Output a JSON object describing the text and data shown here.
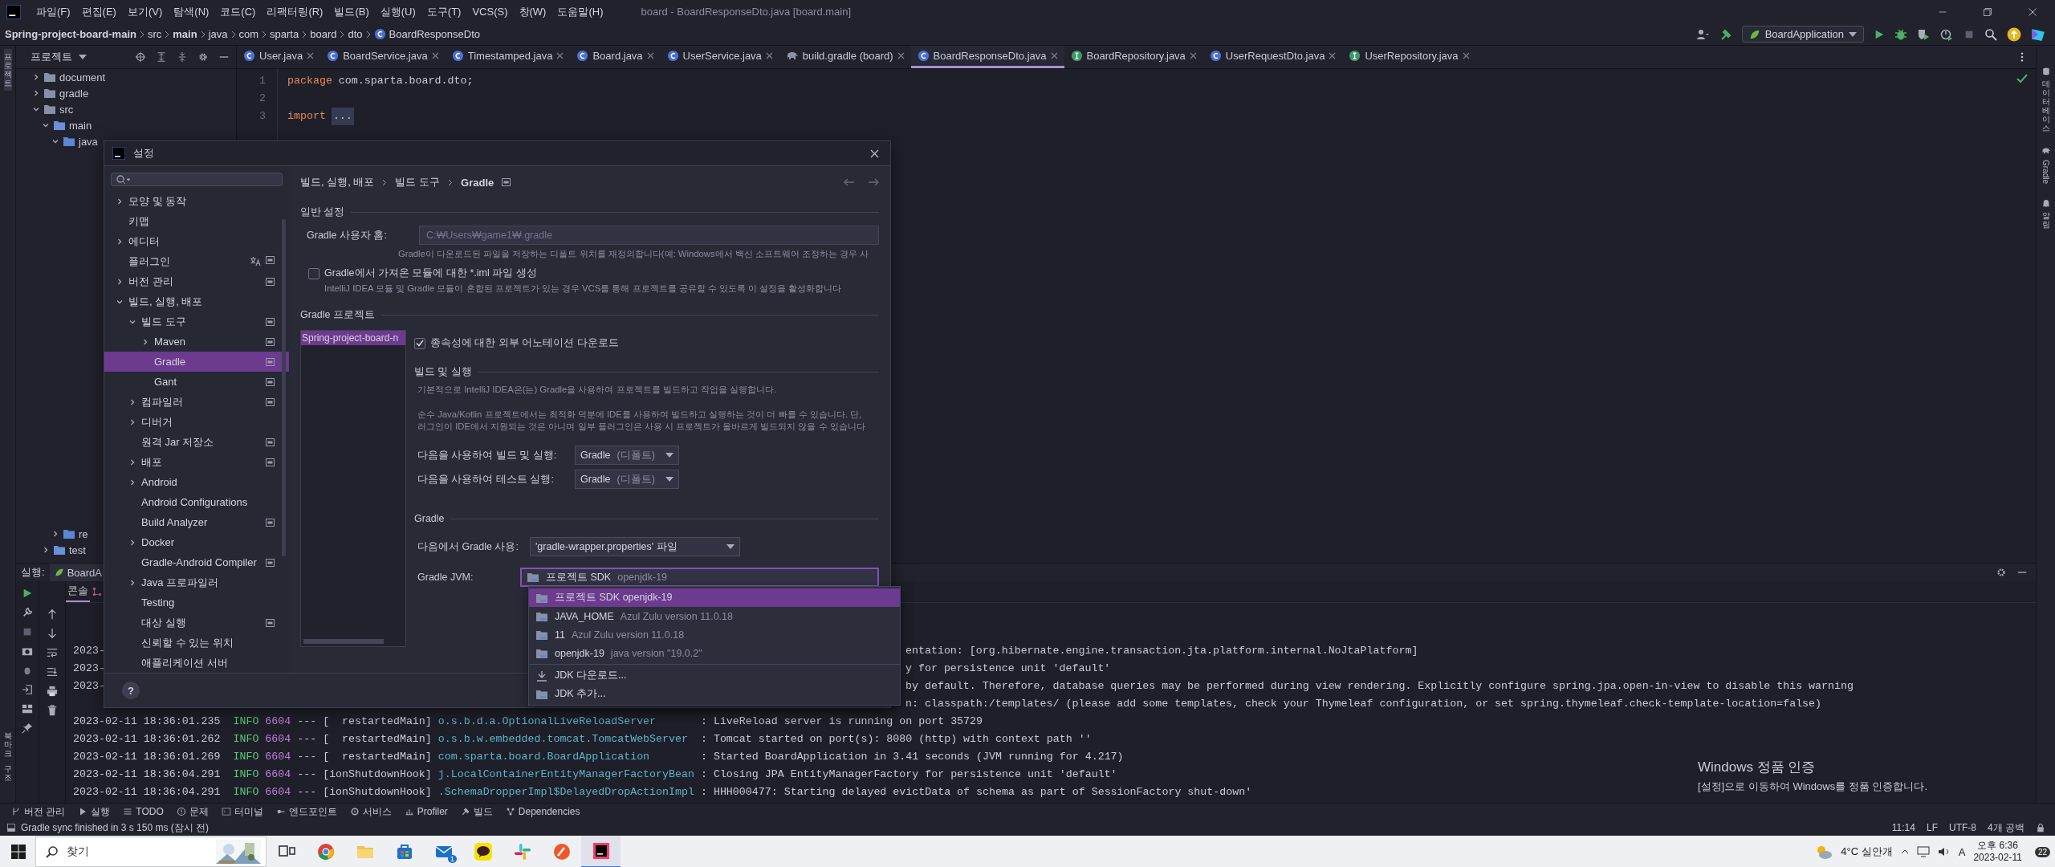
{
  "title_bar": {
    "menus": [
      "파일(F)",
      "편집(E)",
      "보기(V)",
      "탐색(N)",
      "코드(C)",
      "리팩터링(R)",
      "빌드(B)",
      "실행(U)",
      "도구(T)",
      "VCS(S)",
      "창(W)",
      "도움말(H)"
    ],
    "title": "board - BoardResponseDto.java [board.main]"
  },
  "breadcrumb": [
    {
      "label": "Spring-project-board-main",
      "kind": "root"
    },
    {
      "label": "src",
      "kind": "dir"
    },
    {
      "label": "main",
      "kind": "root"
    },
    {
      "label": "java",
      "kind": "dir"
    },
    {
      "label": "com",
      "kind": "dir"
    },
    {
      "label": "sparta",
      "kind": "dir"
    },
    {
      "label": "board",
      "kind": "dir"
    },
    {
      "label": "dto",
      "kind": "dir"
    },
    {
      "label": "BoardResponseDto",
      "kind": "class"
    }
  ],
  "run_config": "BoardApplication",
  "left_stripe": {
    "top": [
      "프로젝트"
    ],
    "bottom": [
      "북마크",
      "구조"
    ]
  },
  "right_stripe": [
    "데이터베이스",
    "Gradle",
    "알림"
  ],
  "project": {
    "title": "프로젝트",
    "tree": [
      {
        "name": "document",
        "expanded": false
      },
      {
        "name": "gradle",
        "expanded": false
      },
      {
        "name": "src",
        "expanded": true,
        "children": [
          {
            "name": "main",
            "expanded": true,
            "children": [
              {
                "name": "java",
                "expanded": true
              },
              {
                "name": "re",
                "expanded": false
              }
            ]
          },
          {
            "name": "test",
            "expanded": false
          }
        ]
      }
    ]
  },
  "editor_tabs": [
    {
      "label": "User.java",
      "kind": "class",
      "selected": false
    },
    {
      "label": "BoardService.java",
      "kind": "class",
      "selected": false
    },
    {
      "label": "Timestamped.java",
      "kind": "class",
      "selected": false
    },
    {
      "label": "Board.java",
      "kind": "class",
      "selected": false
    },
    {
      "label": "UserService.java",
      "kind": "class",
      "selected": false
    },
    {
      "label": "build.gradle (board)",
      "kind": "gradle",
      "selected": false
    },
    {
      "label": "BoardResponseDto.java",
      "kind": "class",
      "selected": true
    },
    {
      "label": "BoardRepository.java",
      "kind": "interface",
      "selected": false
    },
    {
      "label": "UserRequestDto.java",
      "kind": "class",
      "selected": false
    },
    {
      "label": "UserRepository.java",
      "kind": "interface",
      "selected": false
    }
  ],
  "editor": {
    "lines": [
      {
        "number": "1",
        "keyword": "package",
        "code": " com.sparta.board.dto;"
      },
      {
        "number": "2"
      },
      {
        "number": "3",
        "keyword": "import",
        "folded": "..."
      }
    ]
  },
  "settings_dialog": {
    "title": "설정",
    "tree": [
      {
        "label": "모양 및 동작",
        "expanded": false,
        "selected": false,
        "translate": false,
        "scope": false
      },
      {
        "label": "키맵",
        "selected": false,
        "translate": false,
        "scope": false
      },
      {
        "label": "에디터",
        "expanded": false,
        "selected": false,
        "translate": false,
        "scope": false
      },
      {
        "label": "플러그인",
        "selected": false,
        "translate": true,
        "scope": true
      },
      {
        "label": "버전 관리",
        "expanded": false,
        "selected": false,
        "translate": false,
        "scope": true
      },
      {
        "label": "빌드, 실행, 배포",
        "expanded": true,
        "selected": false,
        "translate": false,
        "scope": false,
        "children": [
          {
            "label": "빌드 도구",
            "expanded": true,
            "selected": false,
            "translate": false,
            "scope": true,
            "children": [
              {
                "label": "Maven",
                "expanded": false,
                "selected": false,
                "translate": false,
                "scope": true
              },
              {
                "label": "Gradle",
                "selected": true,
                "translate": false,
                "scope": true
              },
              {
                "label": "Gant",
                "selected": false,
                "translate": false,
                "scope": true
              }
            ]
          },
          {
            "label": "컴파일러",
            "expanded": false,
            "selected": false,
            "translate": false,
            "scope": true
          },
          {
            "label": "디버거",
            "expanded": false,
            "selected": false,
            "translate": false,
            "scope": false
          },
          {
            "label": "원격 Jar 저장소",
            "selected": false,
            "translate": false,
            "scope": true
          },
          {
            "label": "배포",
            "expanded": false,
            "selected": false,
            "translate": false,
            "scope": true
          },
          {
            "label": "Android",
            "expanded": false,
            "selected": false,
            "translate": false,
            "scope": false
          },
          {
            "label": "Android Configurations",
            "selected": false,
            "translate": false,
            "scope": false
          },
          {
            "label": "Build Analyzer",
            "selected": false,
            "translate": false,
            "scope": true
          },
          {
            "label": "Docker",
            "expanded": false,
            "selected": false,
            "translate": false,
            "scope": false
          },
          {
            "label": "Gradle-Android Compiler",
            "selected": false,
            "translate": false,
            "scope": true
          },
          {
            "label": "Java 프로파일러",
            "expanded": false,
            "selected": false,
            "translate": false,
            "scope": false
          },
          {
            "label": "Testing",
            "selected": false,
            "translate": false,
            "scope": false
          },
          {
            "label": "대상 실행",
            "selected": false,
            "translate": false,
            "scope": true
          },
          {
            "label": "신뢰할 수 있는 위치",
            "selected": false,
            "translate": false,
            "scope": false
          },
          {
            "label": "애플리케이션 서버",
            "selected": false,
            "translate": false,
            "scope": false
          }
        ]
      }
    ],
    "breadcrumb": [
      "빌드, 실행, 배포",
      "빌드 도구",
      "Gradle"
    ],
    "general": {
      "heading": "일반 설정",
      "home_label": "Gradle 사용자 홈:",
      "home_value": "C:₩Users₩game1₩.gradle",
      "home_hint": "Gradle이 다운로드된 파일을 저장하는 디폴트 위치를 재정의합니다(예: Windows에서 백신 소프트웨어 조정하는 경우 사",
      "iml": {
        "label": "Gradle에서 가져온 모듈에 대한 *.iml 파일 생성",
        "checked": false,
        "hint": "IntelliJ IDEA 모듈 및 Gradle 모듈이 혼합된 프로젝트가 있는 경우 VCS를 통해 프로젝트를 공유할 수 있도록 이 설정을 활성화합니다"
      }
    },
    "projects": {
      "heading": "Gradle 프로젝트",
      "list": [
        {
          "name": "Spring-project-board-n",
          "selected": true
        }
      ],
      "annotations": {
        "label": "종속성에 대한 외부 어노테이션 다운로드",
        "checked": true
      },
      "build_run": {
        "heading": "빌드 및 실행",
        "info": "기본적으로 IntelliJ IDEA은(는) Gradle을 사용하여 프로젝트를 빌드하고 작업을 실행합니다.",
        "note": [
          "순수 Java/Kotlin 프로젝트에서는 최적화 덕분에 IDE를 사용하여 빌드하고 실행하는 것이 더 빠를 수 있습니다. 단,",
          "러그인이 IDE에서 지원되는 것은 아니며 일부 플러그인은 사용 시 프로젝트가 올바르게 빌드되지 않을 수 있습니다"
        ],
        "fields": [
          {
            "label": "다음을 사용하여 빌드 및 실행:",
            "value": "Gradle",
            "detail": "(디폴트)"
          },
          {
            "label": "다음을 사용하여 테스트 실행:",
            "value": "Gradle",
            "detail": "(디폴트)"
          }
        ]
      },
      "gradle": {
        "heading": "Gradle",
        "source": {
          "label": "다음에서 Gradle 사용:",
          "value": "'gradle-wrapper.properties' 파일"
        },
        "jvm": {
          "label": "Gradle JVM:",
          "value": "프로젝트 SDK",
          "detail": "openjdk-19",
          "options": [
            {
              "name": "프로젝트 SDK openjdk-19",
              "kind": "sdk",
              "selected": true
            },
            {
              "name": "JAVA_HOME",
              "detail": "Azul Zulu version 11.0.18",
              "kind": "sdk",
              "selected": false
            },
            {
              "name": "11",
              "detail": "Azul Zulu version 11.0.18",
              "kind": "sdk",
              "selected": false
            },
            {
              "name": "openjdk-19",
              "detail": "java version \"19.0.2\"",
              "kind": "sdk",
              "selected": false
            },
            {
              "name": "JDK 다운로드...",
              "kind": "download",
              "selected": false
            },
            {
              "name": "JDK 추가...",
              "kind": "add",
              "selected": false
            }
          ]
        }
      }
    },
    "help": "?"
  },
  "run_panel": {
    "label": "실행:",
    "tab": "BoardA",
    "console_tab": "콘솔",
    "log": [
      {
        "kind": "partial",
        "timestamp": "2023-",
        "tail": "entation: [org.hibernate.engine.transaction.jta.platform.internal.NoJtaPlatform]"
      },
      {
        "kind": "partial",
        "timestamp": "2023-",
        "tail": "y for persistence unit 'default'"
      },
      {
        "kind": "partial",
        "timestamp": "2023-",
        "tail": "by default. Therefore, database queries may be performed during view rendering. Explicitly configure spring.jpa.open-in-view to disable this warning"
      },
      {
        "kind": "partial",
        "tail": "n: classpath:/templates/ (please add some templates, check your Thymeleaf configuration, or set spring.thymeleaf.check-template-location=false)"
      },
      {
        "kind": "full",
        "timestamp": "2023-02-11 18:36:01.235",
        "level": "INFO",
        "pid": "6604",
        "separator": "---",
        "thread": "[  restartedMain]",
        "logger": "o.s.b.d.a.OptionalLiveReloadServer",
        "message": ": LiveReload server is running on port 35729"
      },
      {
        "kind": "full",
        "timestamp": "2023-02-11 18:36:01.262",
        "level": "INFO",
        "pid": "6604",
        "separator": "---",
        "thread": "[  restartedMain]",
        "logger": "o.s.b.w.embedded.tomcat.TomcatWebServer",
        "message": ": Tomcat started on port(s): 8080 (http) with context path ''"
      },
      {
        "kind": "full",
        "timestamp": "2023-02-11 18:36:01.269",
        "level": "INFO",
        "pid": "6604",
        "separator": "---",
        "thread": "[  restartedMain]",
        "logger": "com.sparta.board.BoardApplication",
        "message": ": Started BoardApplication in 3.41 seconds (JVM running for 4.217)"
      },
      {
        "kind": "full",
        "timestamp": "2023-02-11 18:36:04.291",
        "level": "INFO",
        "pid": "6604",
        "separator": "---",
        "thread": "[ionShutdownHook]",
        "logger": "j.LocalContainerEntityManagerFactoryBean",
        "message": ": Closing JPA EntityManagerFactory for persistence unit 'default'"
      },
      {
        "kind": "full",
        "timestamp": "2023-02-11 18:36:04.291",
        "level": "INFO",
        "pid": "6604",
        "separator": "---",
        "thread": "[ionShutdownHook]",
        "logger": ".SchemaDropperImpl$DelayedDropActionImpl",
        "message": ": HHH000477: Starting delayed evictData of schema as part of SessionFactory shut-down'"
      }
    ]
  },
  "activation_notice": {
    "title": "Windows 정품 인증",
    "text": "[설정]으로 이동하여 Windows를 정품 인증합니다."
  },
  "tool_windows": [
    {
      "label": "버전 관리",
      "kind": "vcs"
    },
    {
      "label": "실행",
      "kind": "run"
    },
    {
      "label": "TODO",
      "kind": "todo"
    },
    {
      "label": "문제",
      "kind": "problems"
    },
    {
      "label": "터미널",
      "kind": "terminal"
    },
    {
      "label": "엔드포인트",
      "kind": "endpoints"
    },
    {
      "label": "서비스",
      "kind": "services"
    },
    {
      "label": "Profiler",
      "kind": "profiler"
    },
    {
      "label": "빌드",
      "kind": "build"
    },
    {
      "label": "Dependencies",
      "kind": "dependencies"
    }
  ],
  "status_bar": {
    "message": "Gradle sync finished in 3 s 150 ms (잠시 전)",
    "items": [
      "11:14",
      "LF",
      "UTF-8",
      "4개 공백"
    ]
  },
  "taskbar": {
    "search_placeholder": "찾기",
    "apps": [
      {
        "kind": "taskview"
      },
      {
        "kind": "chrome"
      },
      {
        "kind": "files"
      },
      {
        "kind": "store"
      },
      {
        "kind": "mail",
        "badge": "1"
      },
      {
        "kind": "kakao"
      },
      {
        "kind": "slack"
      },
      {
        "kind": "brave"
      },
      {
        "kind": "intellij"
      }
    ],
    "weather": "4°C 실안개",
    "ime": "A",
    "time": "오후 6:36",
    "date": "2023-02-11",
    "notifications": "22"
  }
}
